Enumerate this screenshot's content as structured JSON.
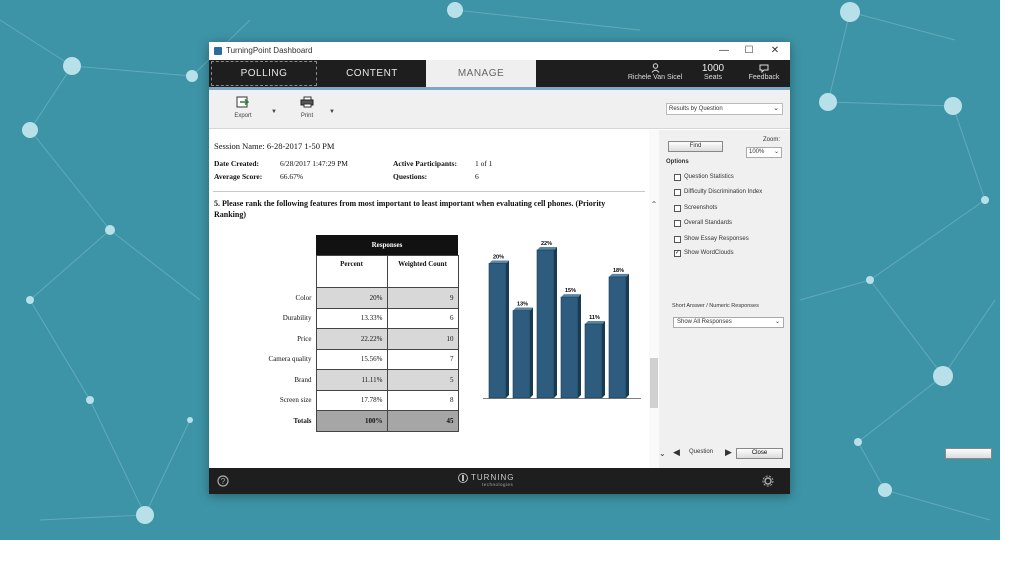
{
  "window": {
    "title": "TurningPoint Dashboard",
    "controls": [
      "—",
      "☐",
      "✕"
    ]
  },
  "nav": {
    "tabs": [
      {
        "label": "POLLING"
      },
      {
        "label": "CONTENT"
      },
      {
        "label": "MANAGE"
      }
    ],
    "user": "Richele Van Sicel",
    "seats_value": "1000",
    "seats_label": "Seats",
    "feedback_label": "Feedback"
  },
  "toolbar": {
    "export_label": "Export",
    "print_label": "Print",
    "results_select": "Results by Question"
  },
  "report": {
    "session": "Session Name: 6-28-2017 1-50 PM",
    "date_created_label": "Date Created:",
    "date_created_value": "6/28/2017 1:47:29 PM",
    "avg_score_label": "Average Score:",
    "avg_score_value": "66.67%",
    "participants_label": "Active Participants:",
    "participants_value": "1 of 1",
    "questions_label": "Questions:",
    "questions_value": "6",
    "question": "5. Please rank the following features from most important to least important when evaluating cell phones. (Priority Ranking)",
    "table": {
      "header": "Responses",
      "col_percent": "Percent",
      "col_weighted": "Weighted Count",
      "rows": [
        {
          "label": "Color",
          "percent": "20%",
          "count": "9"
        },
        {
          "label": "Durability",
          "percent": "13.33%",
          "count": "6"
        },
        {
          "label": "Price",
          "percent": "22.22%",
          "count": "10"
        },
        {
          "label": "Camera quality",
          "percent": "15.56%",
          "count": "7"
        },
        {
          "label": "Brand",
          "percent": "11.11%",
          "count": "5"
        },
        {
          "label": "Screen size",
          "percent": "17.78%",
          "count": "8"
        }
      ],
      "total_label": "Totals",
      "total_percent": "100%",
      "total_count": "45"
    }
  },
  "chart_data": {
    "type": "bar",
    "categories": [
      "Color",
      "Durability",
      "Price",
      "Camera quality",
      "Brand",
      "Screen size"
    ],
    "values": [
      20,
      13,
      22,
      15,
      11,
      18
    ],
    "data_labels": [
      "20%",
      "13%",
      "22%",
      "15%",
      "11%",
      "18%"
    ],
    "ylim": [
      0,
      22
    ],
    "bar_color": "#2e5c7e"
  },
  "sidebar": {
    "find_label": "Find",
    "zoom_label": "Zoom:",
    "zoom_value": "100%",
    "options_label": "Options",
    "options": [
      {
        "label": "Question Statistics",
        "checked": false
      },
      {
        "label": "Difficulty Discrimination Index",
        "checked": false
      },
      {
        "label": "Screenshots",
        "checked": false
      },
      {
        "label": "Overall Standards",
        "checked": false
      },
      {
        "label": "Show Essay Responses",
        "checked": false
      },
      {
        "label": "Show WordClouds",
        "checked": true
      }
    ],
    "short_answer_label": "Short Answer / Numeric Responses",
    "short_answer_select": "Show All Responses",
    "question_nav_label": "Question",
    "close_label": "Close"
  },
  "footer": {
    "brand": "TURNING",
    "brand_sub": "technologies"
  }
}
